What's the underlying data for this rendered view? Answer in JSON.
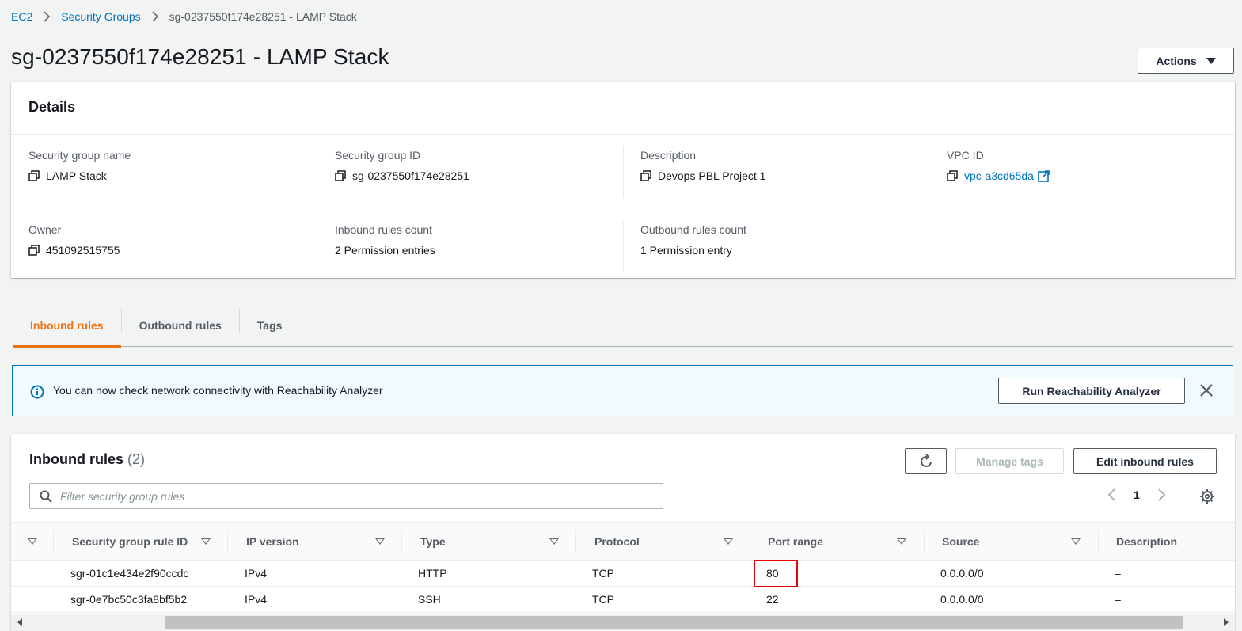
{
  "breadcrumb": {
    "items": [
      "EC2",
      "Security Groups",
      "sg-0237550f174e28251 - LAMP Stack"
    ]
  },
  "page": {
    "title": "sg-0237550f174e28251 - LAMP Stack",
    "actions_label": "Actions"
  },
  "details": {
    "heading": "Details",
    "fields": [
      {
        "label": "Security group name",
        "value": "LAMP Stack"
      },
      {
        "label": "Security group ID",
        "value": "sg-0237550f174e28251"
      },
      {
        "label": "Description",
        "value": "Devops PBL Project 1"
      },
      {
        "label": "VPC ID",
        "value": "vpc-a3cd65da"
      },
      {
        "label": "Owner",
        "value": "451092515755"
      },
      {
        "label": "Inbound rules count",
        "value": "2 Permission entries"
      },
      {
        "label": "Outbound rules count",
        "value": "1 Permission entry"
      }
    ]
  },
  "tabs": [
    "Inbound rules",
    "Outbound rules",
    "Tags"
  ],
  "flash": {
    "message": "You can now check network connectivity with Reachability Analyzer",
    "button": "Run Reachability Analyzer"
  },
  "inbound": {
    "title": "Inbound rules",
    "count": "(2)",
    "manage_tags": "Manage tags",
    "edit_rules": "Edit inbound rules",
    "filter_placeholder": "Filter security group rules",
    "page": "1",
    "columns": [
      "Security group rule ID",
      "IP version",
      "Type",
      "Protocol",
      "Port range",
      "Source",
      "Description"
    ],
    "rows": [
      {
        "id": "sgr-01c1e434e2f90ccdc",
        "ip_version": "IPv4",
        "type": "HTTP",
        "protocol": "TCP",
        "port_range": "80",
        "source": "0.0.0.0/0",
        "description": "–"
      },
      {
        "id": "sgr-0e7bc50c3fa8bf5b2",
        "ip_version": "IPv4",
        "type": "SSH",
        "protocol": "TCP",
        "port_range": "22",
        "source": "0.0.0.0/0",
        "description": "–"
      }
    ]
  },
  "colors": {
    "link": "#0073bb",
    "active_tab": "#ec7211",
    "highlight": "#e60000",
    "info_border": "#0073bb"
  }
}
